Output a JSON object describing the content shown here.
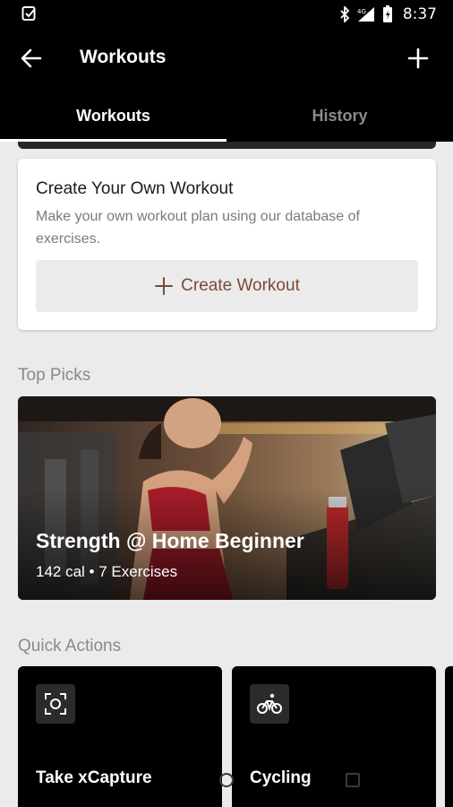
{
  "status_bar": {
    "time": "8:37",
    "network": "4G",
    "icons": [
      "app-notification-icon",
      "bluetooth-icon",
      "signal-icon",
      "battery-icon"
    ]
  },
  "app_bar": {
    "title": "Workouts",
    "back_icon": "arrow-left-icon",
    "add_icon": "plus-icon"
  },
  "tabs": [
    {
      "label": "Workouts",
      "active": true
    },
    {
      "label": "History",
      "active": false
    }
  ],
  "create_card": {
    "heading": "Create Your Own Workout",
    "description": "Make your own workout plan using our database of exercises.",
    "button_label": "Create Workout"
  },
  "top_picks": {
    "section_title": "Top Picks",
    "card": {
      "title": "Strength @ Home Beginner",
      "meta": "142 cal • 7 Exercises"
    }
  },
  "quick_actions": {
    "section_title": "Quick Actions",
    "items": [
      {
        "label": "Take xCapture",
        "icon": "scan-icon"
      },
      {
        "label": "Cycling",
        "icon": "bicycle-icon"
      }
    ]
  },
  "colors": {
    "background": "#ebebeb",
    "bar": "#000000",
    "accent_text": "#7a4b34",
    "muted": "#8a8a8a"
  }
}
